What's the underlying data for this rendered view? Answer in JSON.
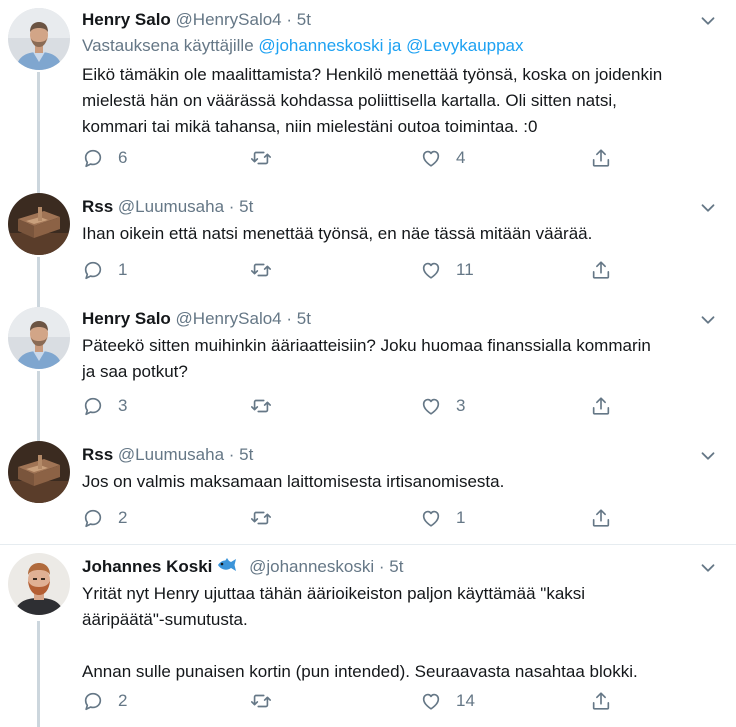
{
  "icons": {
    "reply": "reply-icon",
    "retweet": "retweet-icon",
    "like": "like-icon",
    "share": "share-icon",
    "more": "chevron-down-icon",
    "fish": "fish-emoji-icon"
  },
  "colors": {
    "link": "#1da1f2",
    "secondary": "#657786",
    "text": "#14171a"
  },
  "tweets": [
    {
      "name": "Henry Salo",
      "handle": "@HenrySalo4",
      "time": "5t",
      "reply_prefix": "Vastauksena käyttäjille",
      "reply_users": "@johanneskoski ja @Levykauppax",
      "lines": [
        "Eikö tämäkin ole maalittamista? Henkilö menettää työnsä, koska on joidenkin",
        "mielestä hän on väärässä kohdassa poliittisella kartalla. Oli sitten natsi,",
        "kommari tai mikä tahansa, niin mielestäni outoa toimintaa. :0"
      ],
      "replies": "6",
      "retweets": "",
      "likes": "4"
    },
    {
      "name": "Rss",
      "handle": "@Luumusaha",
      "time": "5t",
      "lines": [
        "Ihan oikein että natsi menettää työnsä, en näe tässä mitään väärää."
      ],
      "replies": "1",
      "retweets": "",
      "likes": "11"
    },
    {
      "name": "Henry Salo",
      "handle": "@HenrySalo4",
      "time": "5t",
      "lines": [
        "Päteekö sitten muihinkin ääriaatteisiin? Joku huomaa finanssialla kommarin",
        "ja saa potkut?"
      ],
      "replies": "3",
      "retweets": "",
      "likes": "3"
    },
    {
      "name": "Rss",
      "handle": "@Luumusaha",
      "time": "5t",
      "lines": [
        "Jos on valmis maksamaan laittomisesta irtisanomisesta."
      ],
      "replies": "2",
      "retweets": "",
      "likes": "1"
    },
    {
      "name": "Johannes Koski",
      "handle": "@johanneskoski",
      "time": "5t",
      "lines": [
        "Yrität nyt Henry ujuttaa tähän äärioikeiston paljon käyttämää \"kaksi",
        "ääripäätä\"-sumutusta.",
        "",
        "Annan sulle punaisen kortin (pun intended). Seuraavasta nasahtaa blokki."
      ],
      "replies": "2",
      "retweets": "",
      "likes": "14"
    }
  ]
}
